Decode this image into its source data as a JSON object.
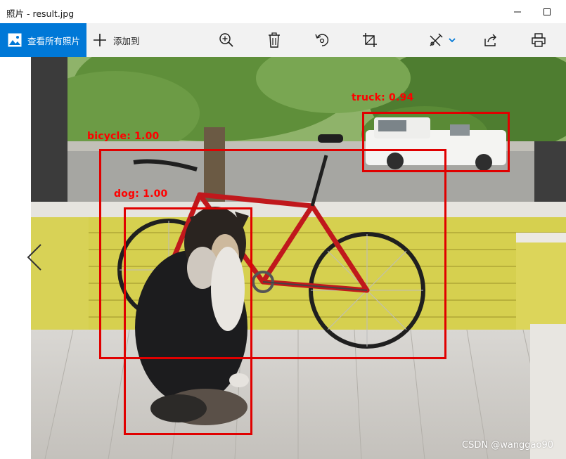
{
  "window": {
    "title": "照片 - result.jpg"
  },
  "toolbar": {
    "view_all_label": "查看所有照片",
    "add_to_label": "添加到",
    "icons": [
      "zoom-in-icon",
      "delete-icon",
      "rotate-icon",
      "crop-icon",
      "edit-icon",
      "share-icon",
      "print-icon"
    ],
    "accent_color": "#0078d7"
  },
  "detections": [
    {
      "label": "truck: 0.94"
    },
    {
      "label": "bicycle: 1.00"
    },
    {
      "label": "dog: 1.00"
    }
  ],
  "detection_color": "#ff0000",
  "watermark": "CSDN @wanggao90"
}
